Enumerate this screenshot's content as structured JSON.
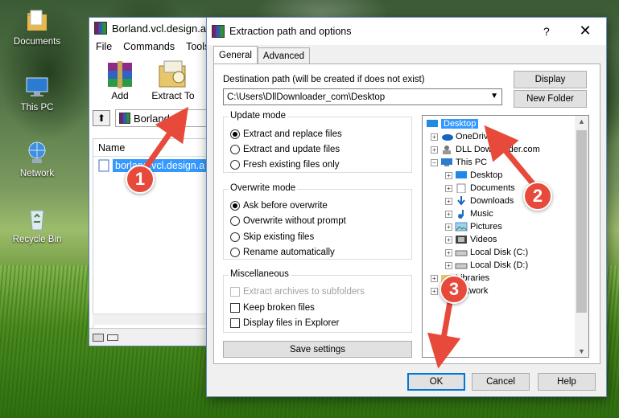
{
  "desktop": {
    "icons": [
      {
        "label": "Documents"
      },
      {
        "label": "This PC"
      },
      {
        "label": "Network"
      },
      {
        "label": "Recycle Bin"
      }
    ]
  },
  "winrar": {
    "title": "Borland.vcl.design.a",
    "menu": [
      "File",
      "Commands",
      "Tools"
    ],
    "tools": [
      {
        "label": "Add"
      },
      {
        "label": "Extract To"
      },
      {
        "label": "T"
      }
    ],
    "address": "Borland.vcl",
    "list_header": "Name",
    "list_item": "borland.vcl.design.a"
  },
  "dialog": {
    "title": "Extraction path and options",
    "help": "?",
    "close": "✕",
    "tabs": [
      {
        "label": "General"
      },
      {
        "label": "Advanced"
      }
    ],
    "dest_label": "Destination path (will be created if does not exist)",
    "dest_value": "C:\\Users\\DllDownloader_com\\Desktop",
    "display_btn": "Display",
    "new_folder_btn": "New Folder",
    "update_mode": {
      "title": "Update mode",
      "options": [
        "Extract and replace files",
        "Extract and update files",
        "Fresh existing files only"
      ],
      "selected": 0
    },
    "overwrite_mode": {
      "title": "Overwrite mode",
      "options": [
        "Ask before overwrite",
        "Overwrite without prompt",
        "Skip existing files",
        "Rename automatically"
      ],
      "selected": 0
    },
    "misc": {
      "title": "Miscellaneous",
      "options": [
        "Extract archives to subfolders",
        "Keep broken files",
        "Display files in Explorer"
      ]
    },
    "save_settings": "Save settings",
    "tree": {
      "desktop": "Desktop",
      "onedrive": "OneDrive",
      "dll": "DLL Downloader.com",
      "this_pc": "This PC",
      "pc_children": [
        "Desktop",
        "Documents",
        "Downloads",
        "Music",
        "Pictures",
        "Videos",
        "Local Disk (C:)",
        "Local Disk (D:)"
      ],
      "libraries": "Libraries",
      "network": "Network"
    },
    "ok": "OK",
    "cancel": "Cancel",
    "help_btn": "Help"
  },
  "annotations": {
    "step1": "1",
    "step2": "2",
    "step3": "3",
    "color": "#e74a3b"
  }
}
